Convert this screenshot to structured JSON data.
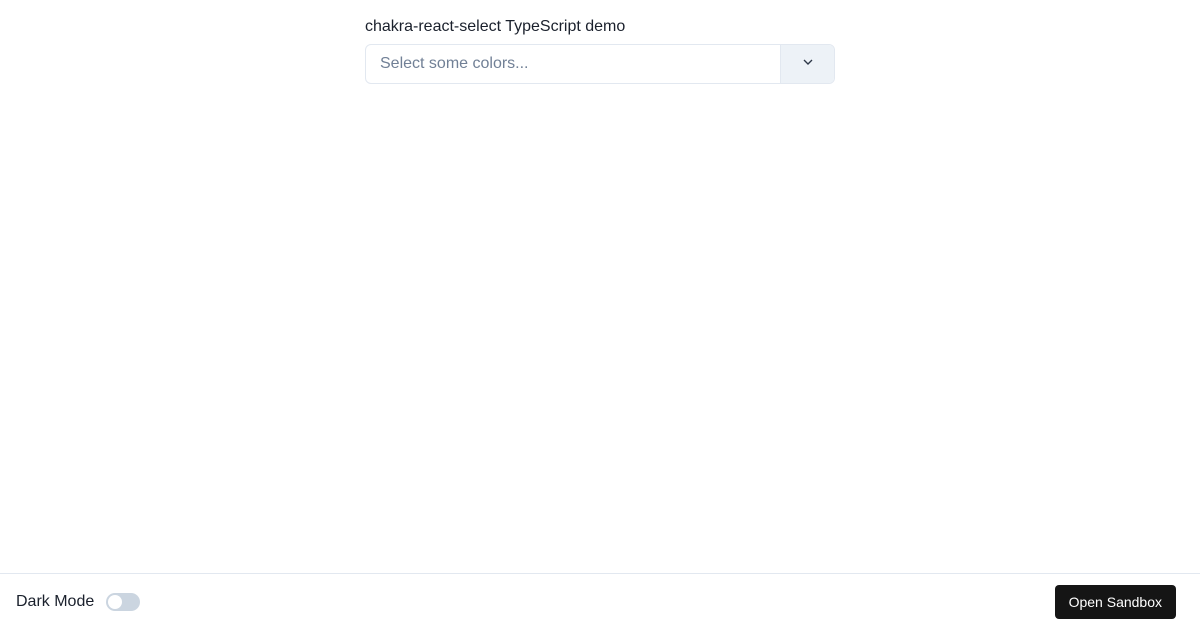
{
  "form": {
    "label": "chakra-react-select TypeScript demo",
    "select": {
      "placeholder": "Select some colors...",
      "value": null
    }
  },
  "footer": {
    "dark_mode_label": "Dark Mode",
    "dark_mode_enabled": false,
    "open_sandbox_label": "Open Sandbox"
  },
  "colors": {
    "border": "#e2e8f0",
    "placeholder": "#718096",
    "indicator_bg": "#edf2f7",
    "toggle_bg": "#cbd5e0",
    "button_bg": "#151515"
  }
}
